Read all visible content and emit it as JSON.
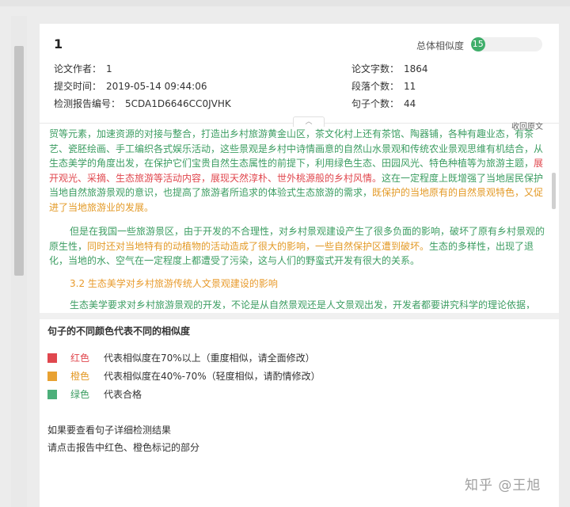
{
  "report": {
    "doc_number": "1",
    "similarity_label": "总体相似度",
    "similarity_value": "15",
    "similarity_percent": 15,
    "author_label": "论文作者：",
    "author_value": "1",
    "submit_label": "提交时间：",
    "submit_value": "2019-05-14 09:44:06",
    "report_id_label": "检测报告编号：",
    "report_id_value": "5CDA1D6646CC0JVHK",
    "word_count_label": "论文字数：",
    "word_count_value": "1864",
    "paragraph_label": "段落个数：",
    "paragraph_value": "11",
    "sentence_label": "句子个数：",
    "sentence_value": "44",
    "collapse_label": "收回原文",
    "toggle_glyph": "︿"
  },
  "content": {
    "p1_green_a": "贸等元素，加速资源的对接与整合，打造出乡村旅游黄金山区，茶文化村上还有茶馆、陶器铺，各种有趣业态，有茶艺、瓷胚绘画、手工编织各式娱乐活动，这些景观是乡村中诗情画意的自然山水景观和传统农业景观思维有机结合，从生态美学的角度出发，在保护它们宝贵自然生态属性的前提下，利用绿色生态、田园风光、特色种植等为旅游主题，",
    "p1_red": "展开观光、采摘、生态旅游等活动内容，展现天然淳朴、世外桃源般的乡村风情。",
    "p1_green_b": "这在一定程度上既增强了当地居民保护当地自然旅游景观的意识，也提高了旅游者所追求的体验式生态旅游的需求，",
    "p1_orange": "既保护的当地原有的自然景观特色，又促进了当地旅游业的发展。",
    "p2_green_a": "但是在我国一些旅游景区，由于开发的不合理性，对乡村景观建设产生了很多负面的影响，破坏了原有乡村景观的原生性，",
    "p2_orange": "同时还对当地特有的动植物的活动造成了很大的影响，一些自然保护区遭到破坏。",
    "p2_green_b": "生态的多样性，出现了退化，当地的水、空气在一定程度上都遭受了污染，这与人们的野蛮式开发有很大的关系。",
    "section_heading": "3.2 生态美学对乡村旅游传统人文景观建设的影响",
    "p3_green": "生态美学要求对乡村旅游景观的开发，不论是从自然景观还是人文景观出发，开发者都要讲究科学的理论依据，"
  },
  "legend": {
    "title": "句子的不同颜色代表不同的相似度",
    "items": [
      {
        "color": "#e0474e",
        "name": "红色",
        "desc": "代表相似度在70%以上（重度相似，请全面修改）"
      },
      {
        "color": "#e8a132",
        "name": "橙色",
        "desc": "代表相似度在40%-70%（轻度相似，请酌情修改）"
      },
      {
        "color": "#4caf7a",
        "name": "绿色",
        "desc": "代表合格"
      }
    ],
    "hint_line1": "如果要查看句子详细检测结果",
    "hint_line2": "请点击报告中红色、橙色标记的部分"
  },
  "watermark": "知乎 @王旭"
}
